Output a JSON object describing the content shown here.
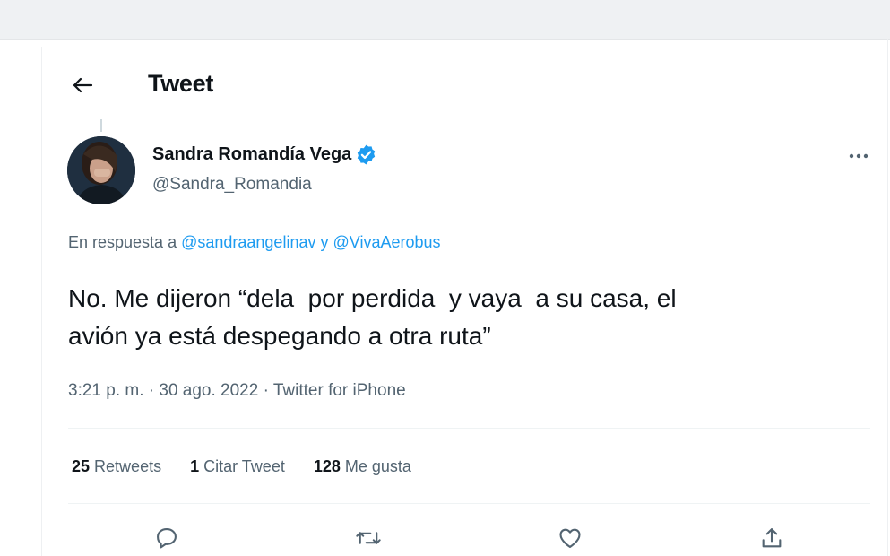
{
  "header": {
    "title": "Tweet",
    "back_icon": "arrow-left-icon"
  },
  "author": {
    "display_name": "Sandra Romandía Vega",
    "handle": "@Sandra_Romandia",
    "verified": true,
    "verified_color": "#1d9bf0"
  },
  "reply": {
    "prefix": "En respuesta a",
    "mention1": "@sandraangelinav",
    "connector": "y",
    "mention2": "@VivaAerobus"
  },
  "tweet": {
    "text": "No. Me dijeron “dela  por perdida  y vaya  a su casa, el\navión ya está despegando a otra ruta”",
    "meta": "3:21 p. m. · 30 ago. 2022 · Twitter for iPhone"
  },
  "stats": {
    "retweets_count": "25",
    "retweets_label": "Retweets",
    "quotes_count": "1",
    "quotes_label": "Citar Tweet",
    "likes_count": "128",
    "likes_label": "Me gusta"
  },
  "actions": [
    "reply-icon",
    "retweet-icon",
    "like-icon",
    "share-icon"
  ],
  "colors": {
    "accent": "#1d9bf0",
    "secondary_text": "#536471",
    "primary_text": "#0f1419"
  }
}
